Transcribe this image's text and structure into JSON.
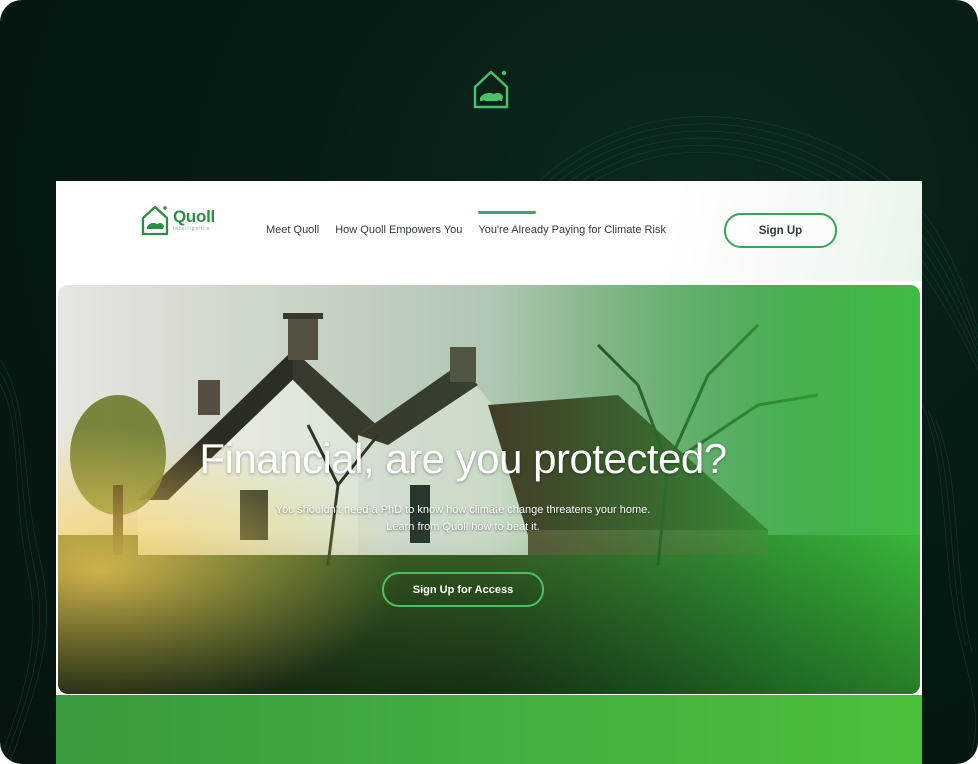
{
  "nav": {
    "brand_name": "Quoll",
    "brand_sub": "Intelligence",
    "links": [
      {
        "label": "Meet Quoll"
      },
      {
        "label": "How Quoll Empowers You"
      },
      {
        "label": "You're  Already Paying for Climate Risk"
      }
    ],
    "signup_label": "Sign Up"
  },
  "hero": {
    "title": "Financial, are you protected?",
    "subtitle_line1": "You shouldn't need a PhD to know how climate change threatens your home.",
    "subtitle_line2": "Learn from Quoll how to beat it.",
    "cta_label": "Sign Up for Access"
  },
  "colors": {
    "background": "#071a14",
    "brand_green": "#2a8f43",
    "accent_green": "#3fa85a",
    "band_green": "#43ae40"
  },
  "icons": {
    "logo": "house-logo-icon"
  }
}
